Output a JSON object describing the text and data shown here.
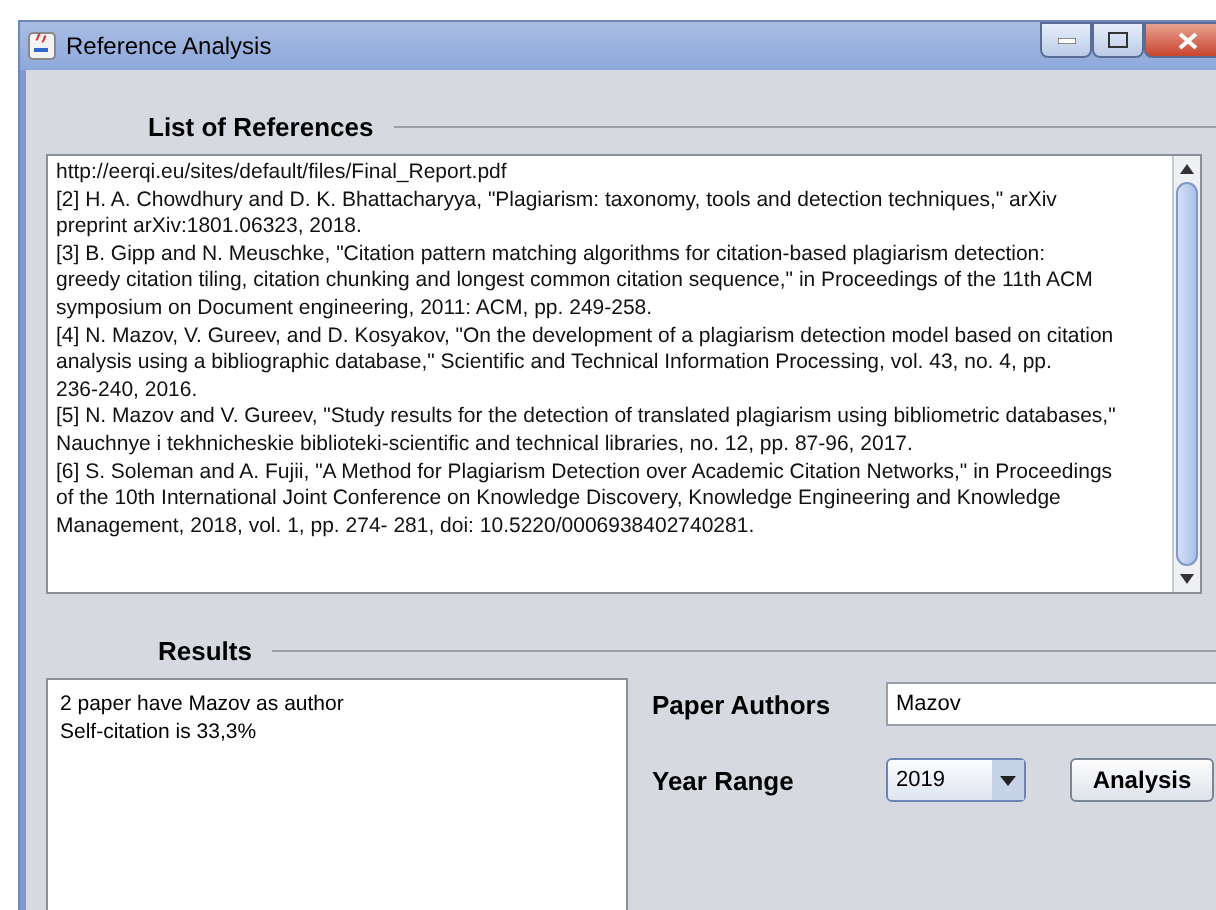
{
  "window": {
    "title": "Reference Analysis"
  },
  "references": {
    "heading": "List of References",
    "lines": [
      "http://eerqi.eu/sites/default/files/Final_Report.pdf",
      "[2] H. A. Chowdhury and D. K. Bhattacharyya, \"Plagiarism: taxonomy, tools and detection techniques,\" arXiv",
      "preprint arXiv:1801.06323, 2018.",
      "[3] B. Gipp and N. Meuschke, \"Citation pattern matching algorithms for citation-based plagiarism detection:",
      "greedy citation tiling, citation chunking and longest common citation sequence,\" in Proceedings of the 11th ACM",
      "symposium on Document engineering, 2011: ACM, pp. 249-258.",
      "[4] N. Mazov, V. Gureev, and D. Kosyakov, \"On the development of a plagiarism detection model based on citation",
      "analysis using a bibliographic database,\" Scientific and Technical Information Processing, vol. 43, no. 4, pp.",
      "236-240, 2016.",
      "[5] N. Mazov and V. Gureev, \"Study results for the detection of translated plagiarism using bibliometric databases,\"",
      "Nauchnye i tekhnicheskie biblioteki-scientific and technical libraries, no. 12, pp. 87-96, 2017.",
      "[6] S. Soleman and A. Fujii, \"A Method for Plagiarism Detection over Academic Citation Networks,\" in Proceedings",
      "of the 10th International Joint Conference on Knowledge Discovery, Knowledge Engineering and Knowledge",
      "Management, 2018, vol. 1, pp. 274-  281, doi: 10.5220/0006938402740281."
    ]
  },
  "results": {
    "heading": "Results",
    "lines": [
      "2 paper have Mazov as author",
      "Self-citation is 33,3%"
    ]
  },
  "form": {
    "authors_label": "Paper Authors",
    "authors_value": "Mazov",
    "year_label": "Year Range",
    "year_value": "2019",
    "button": "Analysis"
  }
}
